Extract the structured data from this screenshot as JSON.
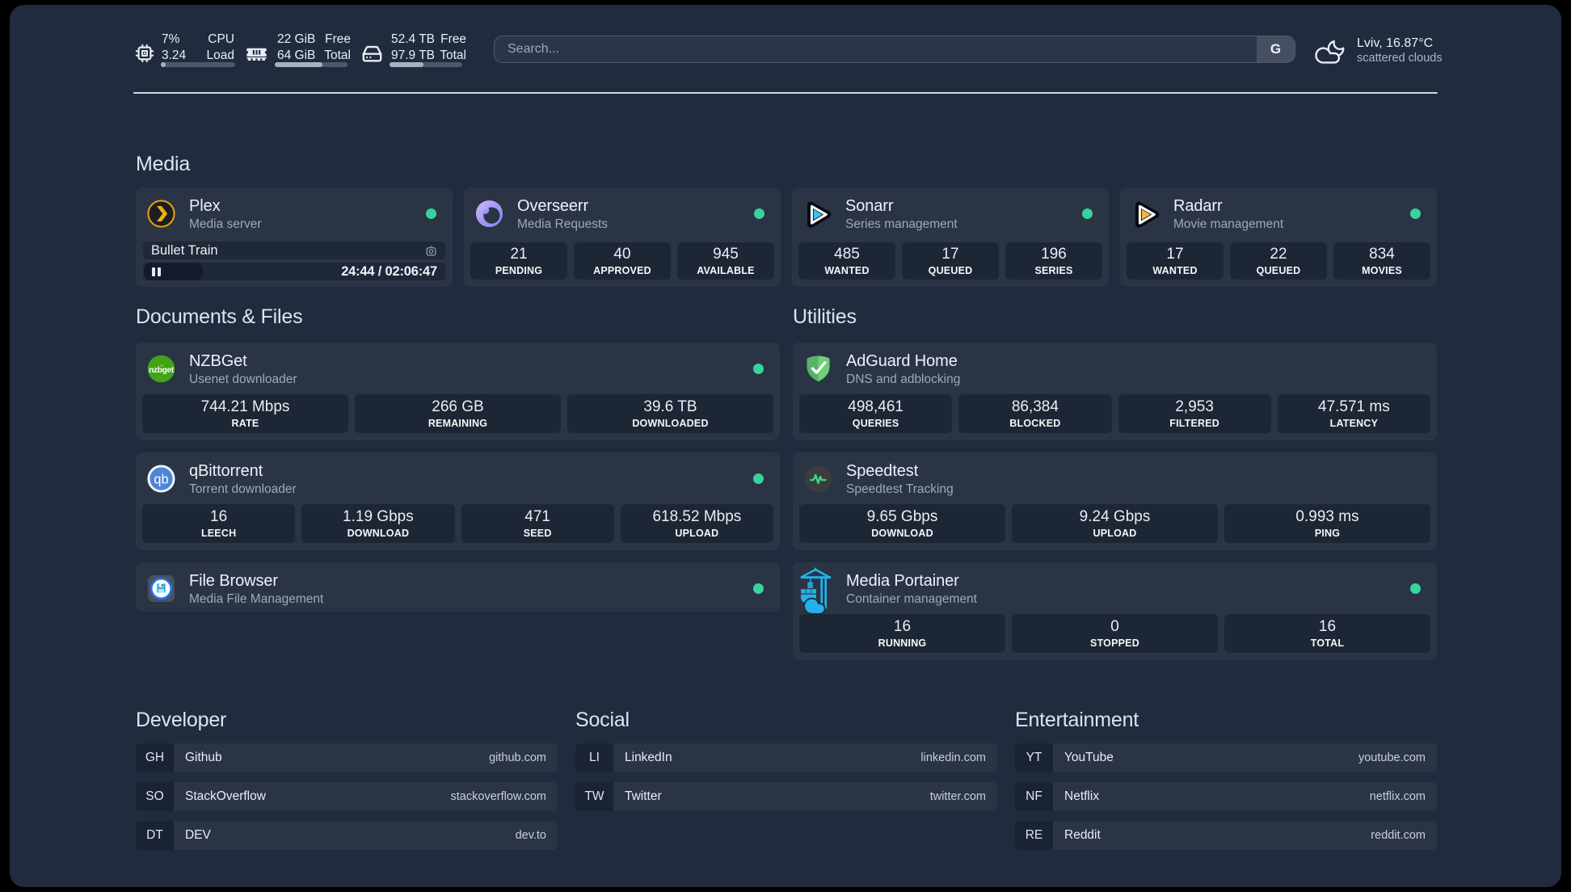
{
  "header": {
    "cpu": {
      "icon": "cpu-icon",
      "value1": "7%",
      "value2": "3.24",
      "label1": "CPU",
      "label2": "Load",
      "progress": 7
    },
    "memory": {
      "icon": "memory-icon",
      "value1": "22 GiB",
      "value2": "64 GiB",
      "label1": "Free",
      "label2": "Total",
      "progress": 66
    },
    "disk": {
      "icon": "disk-icon",
      "value1": "52.4 TB",
      "value2": "97.9 TB",
      "label1": "Free",
      "label2": "Total",
      "progress": 46.5
    },
    "search": {
      "placeholder": "Search...",
      "provider_button": "G"
    },
    "weather": {
      "icon": "cloud-moon-icon",
      "line1": "Lviv, 16.87°C",
      "line2": "scattered clouds"
    }
  },
  "colors": {
    "background": "#212b3e",
    "card": "#2a3445",
    "stat_block": "#1d2634",
    "online_dot": "#36d39a",
    "accent_plex": "#e5a00d",
    "accent_sonarr": "#35c5f4",
    "accent_radarr": "#f9b23a",
    "accent_portainer": "#22b2ea",
    "accent_adguard": "#66c26f"
  },
  "sections": {
    "media": {
      "title": "Media",
      "services": [
        {
          "id": "plex",
          "icon": "plex-icon",
          "name": "Plex",
          "desc": "Media server",
          "online": true,
          "media": {
            "title": "Bullet Train",
            "time": "24:44 / 02:06:47",
            "progress": 19.6
          }
        },
        {
          "id": "overseerr",
          "icon": "overseerr-icon",
          "name": "Overseerr",
          "desc": "Media Requests",
          "online": true,
          "stats": [
            {
              "value": "21",
              "label": "PENDING"
            },
            {
              "value": "40",
              "label": "APPROVED"
            },
            {
              "value": "945",
              "label": "AVAILABLE"
            }
          ]
        },
        {
          "id": "sonarr",
          "icon": "sonarr-icon",
          "name": "Sonarr",
          "desc": "Series management",
          "online": true,
          "stats": [
            {
              "value": "485",
              "label": "WANTED"
            },
            {
              "value": "17",
              "label": "QUEUED"
            },
            {
              "value": "196",
              "label": "SERIES"
            }
          ]
        },
        {
          "id": "radarr",
          "icon": "radarr-icon",
          "name": "Radarr",
          "desc": "Movie management",
          "online": true,
          "stats": [
            {
              "value": "17",
              "label": "WANTED"
            },
            {
              "value": "22",
              "label": "QUEUED"
            },
            {
              "value": "834",
              "label": "MOVIES"
            }
          ]
        }
      ]
    },
    "columns": [
      {
        "title": "Documents & Files",
        "services": [
          {
            "id": "nzbget",
            "icon": "nzbget-icon",
            "name": "NZBGet",
            "desc": "Usenet downloader",
            "online": true,
            "stats": [
              {
                "value": "744.21 Mbps",
                "label": "RATE"
              },
              {
                "value": "266 GB",
                "label": "REMAINING"
              },
              {
                "value": "39.6 TB",
                "label": "DOWNLOADED"
              }
            ]
          },
          {
            "id": "qbittorrent",
            "icon": "qbittorrent-icon",
            "name": "qBittorrent",
            "desc": "Torrent downloader",
            "online": true,
            "stats": [
              {
                "value": "16",
                "label": "LEECH"
              },
              {
                "value": "1.19 Gbps",
                "label": "DOWNLOAD"
              },
              {
                "value": "471",
                "label": "SEED"
              },
              {
                "value": "618.52 Mbps",
                "label": "UPLOAD"
              }
            ]
          },
          {
            "id": "filebrowser",
            "icon": "filebrowser-icon",
            "name": "File Browser",
            "desc": "Media File Management",
            "online": true,
            "stats": []
          }
        ]
      },
      {
        "title": "Utilities",
        "services": [
          {
            "id": "adguard",
            "icon": "adguard-icon",
            "name": "AdGuard Home",
            "desc": "DNS and adblocking",
            "online": false,
            "stats": [
              {
                "value": "498,461",
                "label": "QUERIES"
              },
              {
                "value": "86,384",
                "label": "BLOCKED"
              },
              {
                "value": "2,953",
                "label": "FILTERED"
              },
              {
                "value": "47.571 ms",
                "label": "LATENCY"
              }
            ]
          },
          {
            "id": "speedtest",
            "icon": "speedtest-icon",
            "name": "Speedtest",
            "desc": "Speedtest Tracking",
            "online": false,
            "stats": [
              {
                "value": "9.65 Gbps",
                "label": "DOWNLOAD"
              },
              {
                "value": "9.24 Gbps",
                "label": "UPLOAD"
              },
              {
                "value": "0.993 ms",
                "label": "PING"
              }
            ]
          },
          {
            "id": "portainer",
            "icon": "portainer-icon",
            "name": "Media Portainer",
            "desc": "Container management",
            "online": true,
            "stats": [
              {
                "value": "16",
                "label": "RUNNING"
              },
              {
                "value": "0",
                "label": "STOPPED"
              },
              {
                "value": "16",
                "label": "TOTAL"
              }
            ]
          }
        ]
      }
    ],
    "bookmarks": [
      {
        "title": "Developer",
        "items": [
          {
            "abbr": "GH",
            "name": "Github",
            "url": "github.com"
          },
          {
            "abbr": "SO",
            "name": "StackOverflow",
            "url": "stackoverflow.com"
          },
          {
            "abbr": "DT",
            "name": "DEV",
            "url": "dev.to"
          }
        ]
      },
      {
        "title": "Social",
        "items": [
          {
            "abbr": "LI",
            "name": "LinkedIn",
            "url": "linkedin.com"
          },
          {
            "abbr": "TW",
            "name": "Twitter",
            "url": "twitter.com"
          }
        ]
      },
      {
        "title": "Entertainment",
        "items": [
          {
            "abbr": "YT",
            "name": "YouTube",
            "url": "youtube.com"
          },
          {
            "abbr": "NF",
            "name": "Netflix",
            "url": "netflix.com"
          },
          {
            "abbr": "RE",
            "name": "Reddit",
            "url": "reddit.com"
          }
        ]
      }
    ]
  }
}
